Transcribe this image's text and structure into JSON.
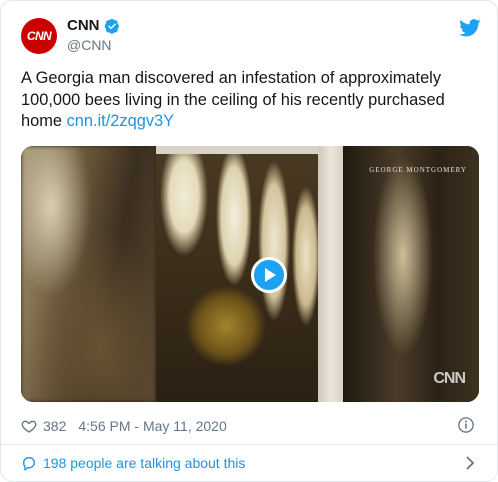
{
  "header": {
    "avatar_text": "CNN",
    "name": "CNN",
    "handle": "@CNN",
    "verified_icon": "verified-badge-icon",
    "brand_icon": "twitter-bird-icon"
  },
  "tweet": {
    "text": "A Georgia man discovered an infestation of approximately 100,000 bees living in the ceiling of his recently purchased home ",
    "link": "cnn.it/2zqgv3Y"
  },
  "media": {
    "credit": "GEORGE MONTGOMERY",
    "watermark": "CNN",
    "play_icon": "play-icon"
  },
  "meta": {
    "likes": "382",
    "timestamp": "4:56 PM - May 11, 2020",
    "info_icon": "info-icon"
  },
  "footer": {
    "talking": "198 people are talking about this"
  },
  "colors": {
    "accent": "#1da1f2",
    "link": "#1b95e0",
    "brand_red": "#cc0000",
    "muted": "#657786"
  }
}
